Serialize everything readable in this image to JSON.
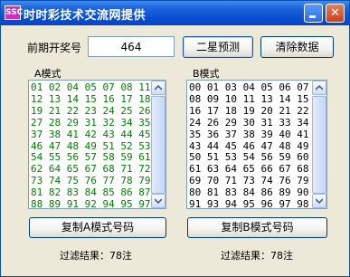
{
  "window": {
    "title": "时时彩技术交流网提供",
    "app_icon_text": "SSC"
  },
  "header": {
    "last_draw_label": "前期开奖号",
    "last_draw_value": "464",
    "predict_button": "二星预测",
    "clear_button": "清除数据"
  },
  "mode_a": {
    "label": "A模式",
    "numbers": [
      "01 02 04 05 07 08 11",
      "12 13 14 15 16 17 18",
      "19 21 22 23 24 25 26",
      "27 28 29 31 32 34 35",
      "37 38 41 42 43 44 45",
      "46 47 48 49 51 52 53",
      "54 55 56 57 58 59 61",
      "62 64 65 67 68 71 72",
      "73 74 75 76 77 78 79",
      "81 82 83 84 85 86 87",
      "88 89 91 92 94 95 97"
    ],
    "copy_button": "复制A模式号码",
    "result": "过滤结果：78注"
  },
  "mode_b": {
    "label": "B模式",
    "numbers": [
      "00 01 03 04 05 06 07",
      "08 09 10 11 13 14 15",
      "16 17 18 19 20 21 22",
      "24 26 29 30 31 33 34",
      "35 36 37 38 39 40 41",
      "43 44 45 46 47 48 49",
      "50 51 53 54 56 59 60",
      "61 63 64 65 66 67 68",
      "69 70 71 73 74 76 79",
      "80 81 83 84 86 89 90",
      "91 93 94 95 96 97 98"
    ],
    "copy_button": "复制B模式号码",
    "result": "过滤结果：78注"
  }
}
